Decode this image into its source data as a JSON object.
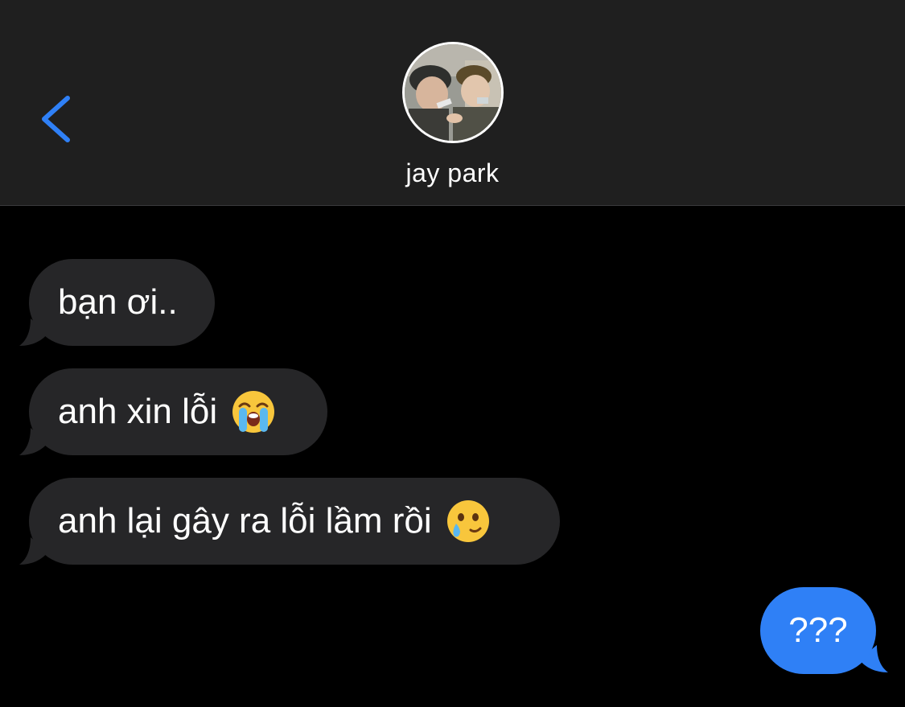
{
  "header": {
    "contact_name": "jay park",
    "back_icon": "chevron-left-icon",
    "avatar_icon": "contact-photo"
  },
  "colors": {
    "header_bg": "#1f1f1f",
    "thread_bg": "#000000",
    "incoming_bubble": "#262628",
    "outgoing_bubble": "#2f80f6",
    "accent": "#2f80f6",
    "text": "#ffffff"
  },
  "messages": [
    {
      "direction": "incoming",
      "text": "bạn ơi..",
      "emoji": ""
    },
    {
      "direction": "incoming",
      "text": "anh xin lỗi",
      "emoji": "loudly-crying-face"
    },
    {
      "direction": "incoming",
      "text": "anh lại gây ra lỗi lầm rồi",
      "emoji": "face-holding-back-tears"
    },
    {
      "direction": "outgoing",
      "text": "???",
      "emoji": ""
    }
  ]
}
